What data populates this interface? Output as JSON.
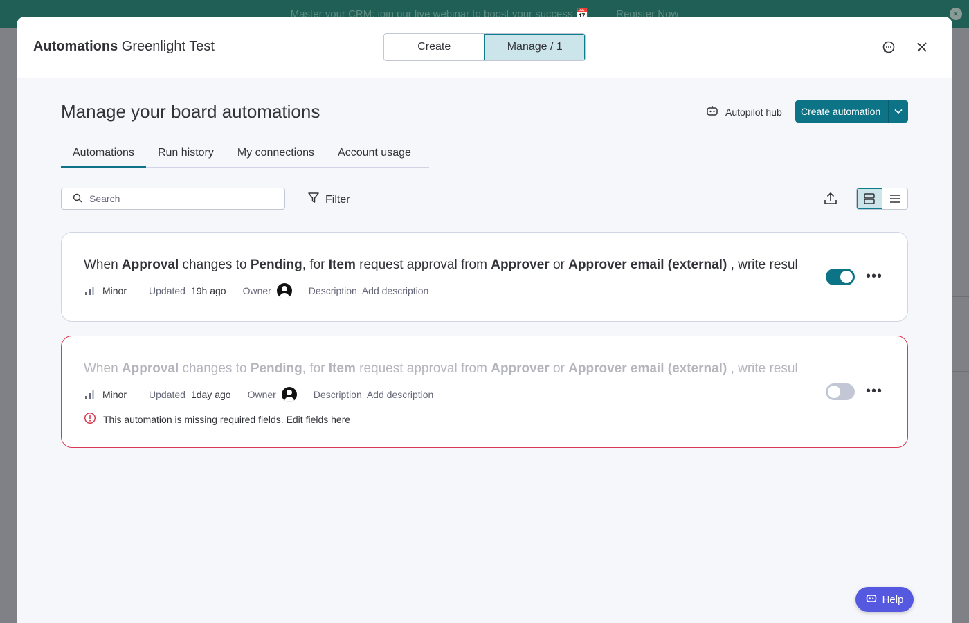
{
  "banner": {
    "text": "Master your CRM: join our live webinar to boost your success 📅",
    "link": "Register Now",
    "close": "×"
  },
  "header": {
    "title_bold": "Automations",
    "title_board": "Greenlight Test",
    "segments": {
      "create": "Create",
      "manage": "Manage / 1"
    },
    "icons": [
      "feedback-icon",
      "close-icon"
    ]
  },
  "page": {
    "title": "Manage your board automations",
    "autopilot_label": "Autopilot hub",
    "create_button": "Create automation"
  },
  "tabs": [
    "Automations",
    "Run history",
    "My connections",
    "Account usage"
  ],
  "toolbar": {
    "search_placeholder": "Search",
    "filter_label": "Filter"
  },
  "automations": [
    {
      "state": "enabled",
      "sentence": {
        "p1": "When ",
        "b1": "Approval",
        "p2": " changes to ",
        "b2": "Pending",
        "p3": ", for ",
        "b3": "Item",
        "p4": " request approval from ",
        "b4": "Approver",
        "p5": " or ",
        "b5": "Approver email (external)",
        "p6": " , write resul"
      },
      "priority": "Minor",
      "updated_label": "Updated",
      "updated_value": "19h ago",
      "owner_label": "Owner",
      "description_label": "Description",
      "description_link": "Add description",
      "enabled": true
    },
    {
      "state": "error",
      "sentence": {
        "p1": "When ",
        "b1": "Approval",
        "p2": " changes to ",
        "b2": "Pending",
        "p3": ", for ",
        "b3": "Item",
        "p4": " request approval from ",
        "b4": "Approver",
        "p5": " or ",
        "b5": "Approver email (external)",
        "p6": " , write resul"
      },
      "priority": "Minor",
      "updated_label": "Updated",
      "updated_value": "1day ago",
      "owner_label": "Owner",
      "description_label": "Description",
      "description_link": "Add description",
      "enabled": false,
      "error_text": "This automation is missing required fields.",
      "error_link": "Edit fields here"
    }
  ],
  "help_label": "Help",
  "colors": {
    "accent": "#0d7387",
    "error": "#d83a52",
    "help": "#5559df"
  }
}
